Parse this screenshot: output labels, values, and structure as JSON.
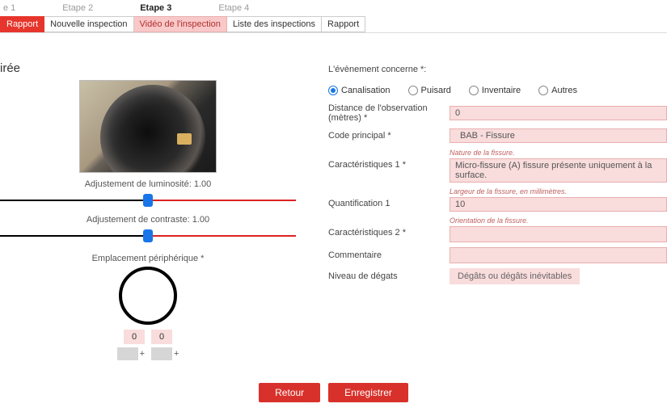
{
  "steps": {
    "items": [
      "e 1",
      "Etape 2",
      "Etape 3",
      "Etape 4"
    ],
    "active_index": 2
  },
  "tabs": {
    "items": [
      {
        "label": "Rapport",
        "style": "red"
      },
      {
        "label": "Nouvelle inspection",
        "style": "plain"
      },
      {
        "label": "Vidéo de l'inspection",
        "style": "pink"
      },
      {
        "label": "Liste des inspections",
        "style": "plain"
      },
      {
        "label": "Rapport",
        "style": "plain"
      }
    ]
  },
  "left": {
    "title": "irée",
    "brightness_label": "Adjustement de luminosité: 1.00",
    "contrast_label": "Adjustement de contraste: 1.00",
    "periph_label": "Emplacement périphérique *",
    "periph_values": [
      "0",
      "0"
    ]
  },
  "right": {
    "concern_label": "L'évènement concerne *:",
    "radios": [
      {
        "label": "Canalisation",
        "checked": true
      },
      {
        "label": "Puisard",
        "checked": false
      },
      {
        "label": "Inventaire",
        "checked": false
      },
      {
        "label": "Autres",
        "checked": false
      }
    ],
    "distance_label": "Distance de l'observation (mètres) *",
    "distance_value": "0",
    "code_label": "Code principal *",
    "code_value": "BAB - Fissure",
    "carac1_label": "Caractéristiques 1 *",
    "carac1_hint": "Nature de la fissure.",
    "carac1_value": "Micro-fissure (A) fissure présente uniquement à la surface.",
    "quant_label": "Quantification 1",
    "quant_hint": "Largeur de la fissure, en millimètres.",
    "quant_value": "10",
    "carac2_label": "Caractéristiques 2 *",
    "carac2_hint": "Orientation de la fissure.",
    "carac2_value": "",
    "comment_label": "Commentaire",
    "comment_value": "",
    "niveau_label": "Niveau de dégats",
    "niveau_btn": "Dégâts ou dégâts inévitables"
  },
  "buttons": {
    "back": "Retour",
    "save": "Enregistrer"
  }
}
